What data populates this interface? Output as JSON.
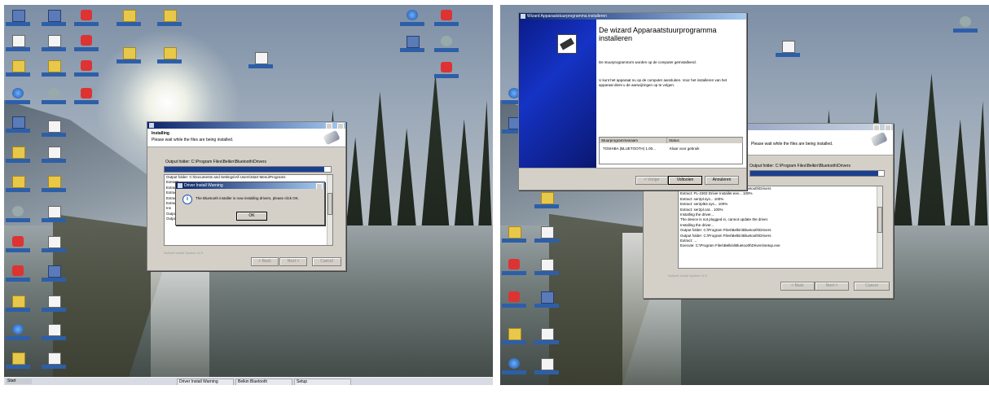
{
  "left": {
    "desktop_captions": [
      "",
      "",
      "",
      "",
      "",
      "",
      "",
      "",
      "",
      "",
      "",
      "",
      "",
      "",
      "",
      "",
      "",
      "",
      "",
      "",
      "",
      "",
      "",
      "",
      "",
      "",
      "",
      ""
    ],
    "installer": {
      "title": "",
      "header_title": "Installing",
      "header_subtitle": "Please wait while the files are being installed.",
      "progress_label": "Output folder: C:\\Program Files\\Belkin\\Bluetooth\\Drivers",
      "progress": 0.96,
      "log_lines": [
        "Output folder: C:\\Documents and Settings\\All Users\\Start Menu\\Programs",
        "Extract:",
        "Extract:",
        "Extract:",
        "Extract:",
        "Extract:",
        "Ins",
        "Output folder: C:\\Program Files\\Belkin\\Bluetooth\\Drivers",
        "Output folder: C:\\Program Files\\Belkin\\Bluetooth\\Drivers"
      ],
      "buttons": [
        "< Back",
        "Next >",
        "Cancel"
      ],
      "status": "Nullsoft Install System v2.0"
    },
    "msgbox": {
      "title": "Driver Install Warning",
      "message": "The Bluetooth installer is now installing drivers, please click OK.",
      "ok": "OK"
    },
    "taskbar": {
      "start": "Start",
      "tasks": [
        "Driver Install Warning",
        "Belkin Bluetooth",
        "Setup"
      ],
      "clock": ""
    }
  },
  "right": {
    "wizard": {
      "title": "Wizard Apparaatstuurprogramma installeren",
      "heading": "De wizard Apparaatstuurprogramma installeren",
      "text1": "De stuurprogramma's worden op de computer geïnstalleerd.",
      "text2": "U kunt het apparaat nu op de computer aansluiten. Voor het installeren van het apparaat dient u de aanwijzingen op te volgen.",
      "col_driver": "Stuurprogrammanaam",
      "col_status": "Status",
      "driver_name": "TOSHIBA (BLUETOOTH) 1.00...",
      "driver_status": "Klaar voor gebruik",
      "buttons": [
        "< Vorige",
        "Voltooien",
        "Annuleren"
      ]
    },
    "installer": {
      "header_title": "",
      "header_subtitle": "Please wait while the files are being installed.",
      "progress_label": "Output folder: C:\\Program Files\\Belkin\\Bluetooth\\Drivers",
      "progress": 0.96,
      "log_lines": [
        "Output folder: C:\\Program Files\\Belkin\\Bluetooth\\Drivers",
        "Extract: PL-2303 Driver Installer.exe... 100%",
        "Extract: ser2pl.sys... 100%",
        "Extract: ser2pl64.sys... 100%",
        "Extract: ser2pl.cat... 100%",
        "Installing the driver...",
        "The device is not plugged in, cannot update the driver.",
        "Installing the driver...",
        "Output folder: C:\\Program Files\\Belkin\\Bluetooth\\Drivers",
        "Output folder: C:\\Program Files\\Belkin\\Bluetooth\\Drivers",
        "Extract: ...",
        "Execute: C:\\Program Files\\Belkin\\Bluetooth\\Drivers\\setup.exe"
      ],
      "buttons": [
        "< Back",
        "Next >",
        "Cancel"
      ],
      "status": "Nullsoft Install System v2.0"
    }
  },
  "colors": {
    "title_bar": "#0a246a",
    "progress_fill": "#1b3f8f",
    "wizard_sidebar": "#1533c4",
    "desktop_caption": "#2d5fa8"
  }
}
